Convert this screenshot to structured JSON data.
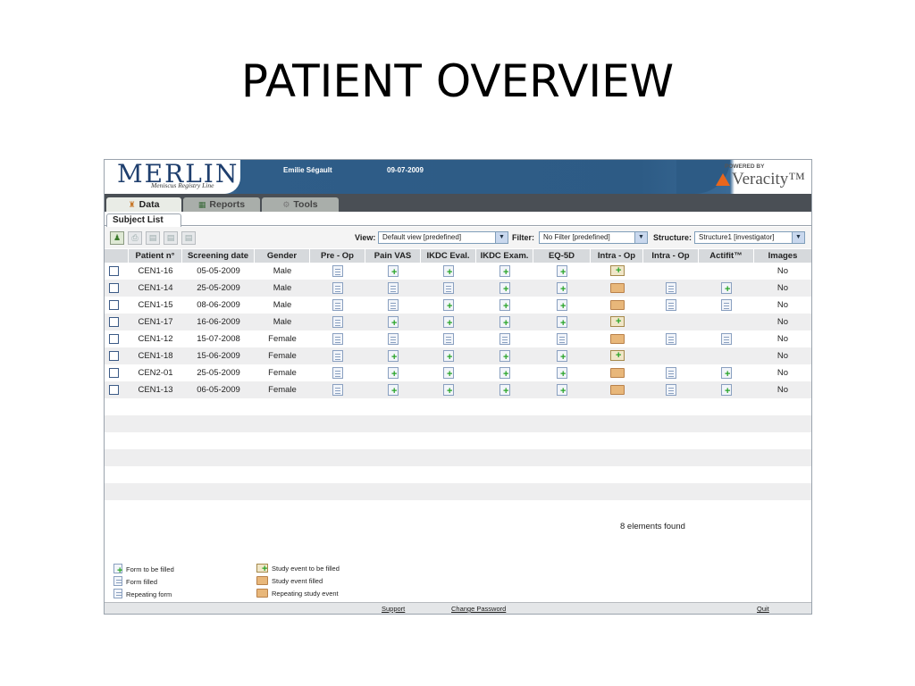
{
  "slide_title": "PATIENT OVERVIEW",
  "header": {
    "logo": "MERLIN",
    "logo_subtitle": "Meniscus Registry Line",
    "user": "Emilie Ségault",
    "date": "09-07-2009",
    "powered_by": "POWERED BY",
    "brand": "Veracity™"
  },
  "tabs": [
    {
      "label": "Data",
      "icon": "home-icon"
    },
    {
      "label": "Reports",
      "icon": "chart-icon"
    },
    {
      "label": "Tools",
      "icon": "gear-icon"
    }
  ],
  "subtab": "Subject List",
  "toolbar": {
    "view_label": "View:",
    "view_value": "Default view [predefined]",
    "filter_label": "Filter:",
    "filter_value": "No Filter [predefined]",
    "structure_label": "Structure:",
    "structure_value": "Structure1 [investigator]"
  },
  "columns": [
    "Patient n°",
    "Screening date",
    "Gender",
    "Pre - Op",
    "Pain VAS",
    "IKDC Eval.",
    "IKDC Exam.",
    "EQ-5D",
    "Intra - Op",
    "Intra - Op",
    "Actifit™",
    "Images"
  ],
  "rows": [
    {
      "patient": "CEN1-16",
      "date": "05-05-2009",
      "gender": "Male",
      "status": [
        "filled",
        "tobe",
        "tobe",
        "tobe",
        "tobe",
        "event-tobe",
        "",
        "",
        ""
      ],
      "images": "No"
    },
    {
      "patient": "CEN1-14",
      "date": "25-05-2009",
      "gender": "Male",
      "status": [
        "filled",
        "filled",
        "filled",
        "tobe",
        "tobe",
        "event-filled",
        "filled",
        "tobe",
        ""
      ],
      "images": "No"
    },
    {
      "patient": "CEN1-15",
      "date": "08-06-2009",
      "gender": "Male",
      "status": [
        "filled",
        "filled",
        "tobe",
        "tobe",
        "tobe",
        "event-filled",
        "filled",
        "filled",
        ""
      ],
      "images": "No"
    },
    {
      "patient": "CEN1-17",
      "date": "16-06-2009",
      "gender": "Male",
      "status": [
        "filled",
        "tobe",
        "tobe",
        "tobe",
        "tobe",
        "event-tobe",
        "",
        "",
        ""
      ],
      "images": "No"
    },
    {
      "patient": "CEN1-12",
      "date": "15-07-2008",
      "gender": "Female",
      "status": [
        "filled",
        "filled",
        "filled",
        "filled",
        "filled",
        "event-filled",
        "filled",
        "filled",
        ""
      ],
      "images": "No"
    },
    {
      "patient": "CEN1-18",
      "date": "15-06-2009",
      "gender": "Female",
      "status": [
        "filled",
        "tobe",
        "tobe",
        "tobe",
        "tobe",
        "event-tobe",
        "",
        "",
        ""
      ],
      "images": "No"
    },
    {
      "patient": "CEN2-01",
      "date": "25-05-2009",
      "gender": "Female",
      "status": [
        "filled",
        "tobe",
        "tobe",
        "tobe",
        "tobe",
        "event-filled",
        "filled",
        "tobe",
        ""
      ],
      "images": "No"
    },
    {
      "patient": "CEN1-13",
      "date": "06-05-2009",
      "gender": "Female",
      "status": [
        "filled",
        "tobe",
        "tobe",
        "tobe",
        "tobe",
        "event-filled",
        "filled",
        "tobe",
        ""
      ],
      "images": "No"
    }
  ],
  "elements_found": "8 elements found",
  "legend": {
    "form_tobe": "Form to be filled",
    "form_filled": "Form filled",
    "repeating_form": "Repeating form",
    "event_tobe": "Study event to be filled",
    "event_filled": "Study event filled",
    "repeating_event": "Repeating study event"
  },
  "footer": {
    "support": "Support",
    "change_password": "Change Password",
    "quit": "Quit"
  },
  "colors": {
    "banner_blue": "#2d5b85",
    "tab_bar": "#4a4f55",
    "accent_orange": "#e8661c",
    "form_add_green": "#28a428"
  }
}
